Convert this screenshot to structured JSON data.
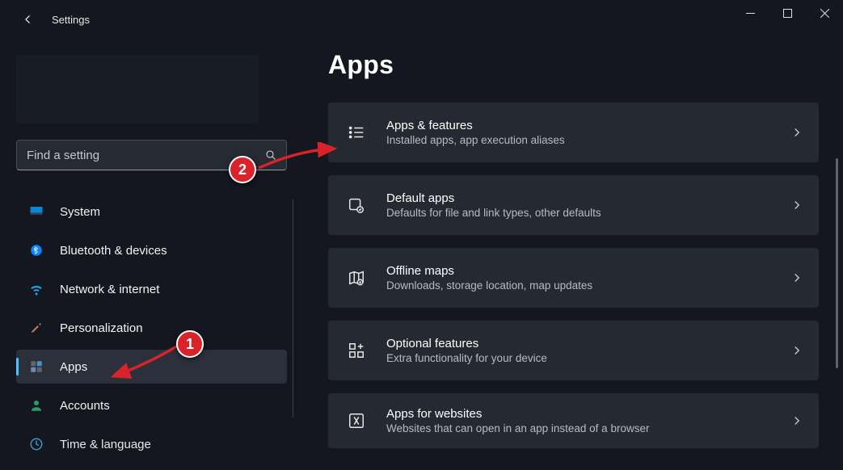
{
  "windowTitle": "Settings",
  "search": {
    "placeholder": "Find a setting"
  },
  "page": {
    "title": "Apps"
  },
  "sidebar": {
    "items": [
      {
        "label": "System"
      },
      {
        "label": "Bluetooth & devices"
      },
      {
        "label": "Network & internet"
      },
      {
        "label": "Personalization"
      },
      {
        "label": "Apps"
      },
      {
        "label": "Accounts"
      },
      {
        "label": "Time & language"
      }
    ]
  },
  "cards": [
    {
      "title": "Apps & features",
      "subtitle": "Installed apps, app execution aliases"
    },
    {
      "title": "Default apps",
      "subtitle": "Defaults for file and link types, other defaults"
    },
    {
      "title": "Offline maps",
      "subtitle": "Downloads, storage location, map updates"
    },
    {
      "title": "Optional features",
      "subtitle": "Extra functionality for your device"
    },
    {
      "title": "Apps for websites",
      "subtitle": "Websites that can open in an app instead of a browser"
    }
  ],
  "annotations": {
    "callout1": "1",
    "callout2": "2"
  }
}
